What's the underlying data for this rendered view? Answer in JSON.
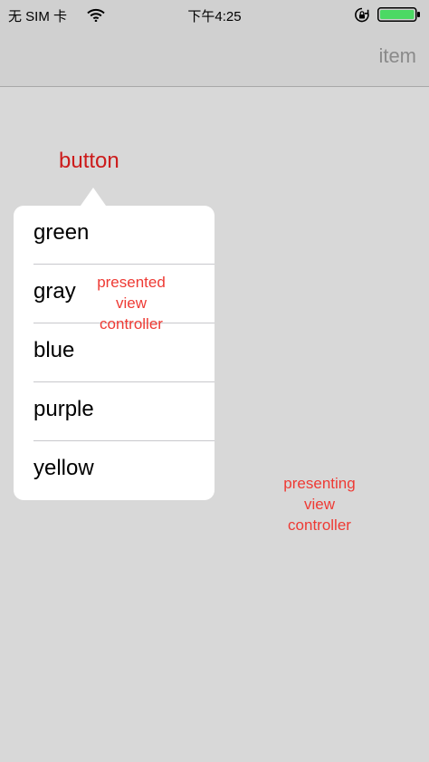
{
  "status_bar": {
    "carrier": "无 SIM 卡",
    "time": "下午4:25",
    "battery_color": "#4cd964"
  },
  "nav_bar": {
    "right_item": "item"
  },
  "main": {
    "button_label": "button",
    "button_color": "#cc1b1b"
  },
  "popover": {
    "items": [
      {
        "label": "green"
      },
      {
        "label": "gray"
      },
      {
        "label": "blue"
      },
      {
        "label": "purple"
      },
      {
        "label": "yellow"
      }
    ]
  },
  "annotations": {
    "presented": [
      "presented",
      "view",
      "controller"
    ],
    "presenting": [
      "presenting",
      "view",
      "controller"
    ]
  }
}
